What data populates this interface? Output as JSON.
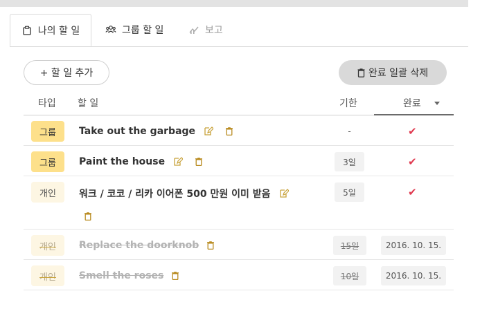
{
  "tabs": [
    {
      "label": "나의 할 일",
      "icon": "clipboard-icon",
      "active": true
    },
    {
      "label": "그룹 할 일",
      "icon": "users-icon",
      "active": false
    },
    {
      "label": "보고",
      "icon": "chart-icon",
      "active": false
    }
  ],
  "toolbar": {
    "add_label": "+ 할 일 추가",
    "bulk_delete_label": "완료 일괄 삭제"
  },
  "table": {
    "headers": {
      "type": "타입",
      "task": "할 일",
      "due": "기한",
      "done": "완료"
    },
    "rows": [
      {
        "type": "그룹",
        "task": "Take out the garbage",
        "due": "-",
        "done": "✔"
      },
      {
        "type": "그룹",
        "task": "Paint the house",
        "due": "3일",
        "done": "✔"
      },
      {
        "type": "개인",
        "task": "워크 / 코코 / 리카 이어폰 500 만원 이미 받음",
        "due": "5일",
        "done": "✔"
      },
      {
        "type": "개인",
        "task": "Replace the doorknob",
        "due": "15일",
        "done": "2016. 10. 15."
      },
      {
        "type": "개인",
        "task": "Smell the roses",
        "due": "10일",
        "done": "2016. 10. 15."
      }
    ]
  },
  "colors": {
    "group_badge": "#fde08b",
    "personal_badge": "#fdf6e3",
    "check": "#e0394f",
    "edit_icon": "#c8a23a",
    "trash_icon": "#b88a1e"
  }
}
